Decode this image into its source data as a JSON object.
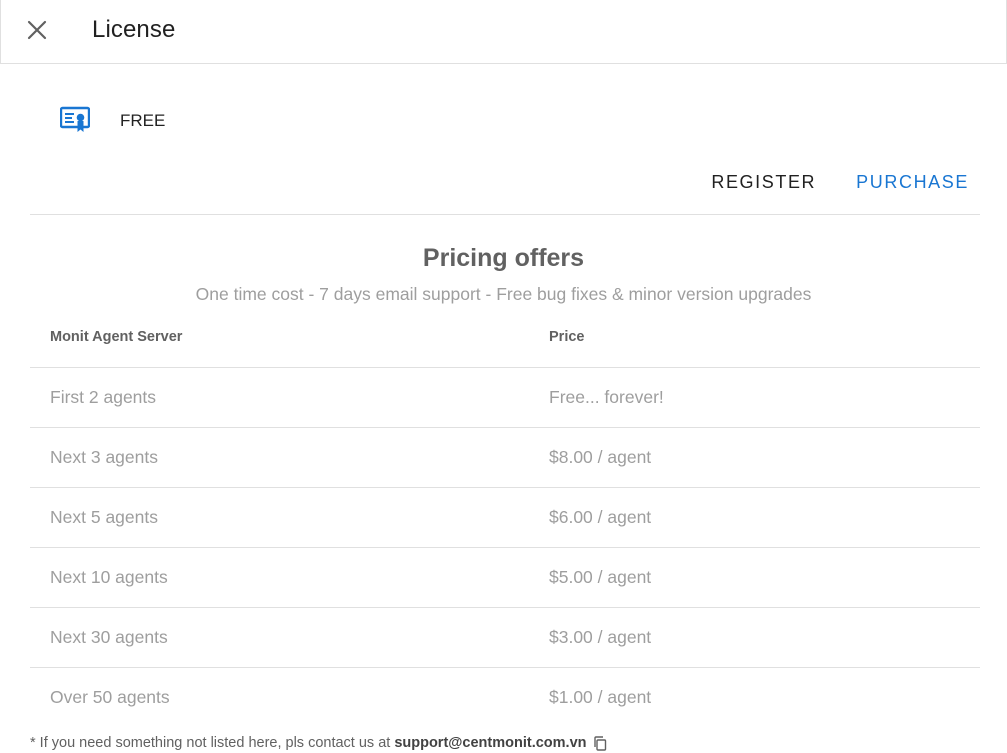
{
  "toolbar": {
    "title": "License",
    "close_icon": "close-icon"
  },
  "license": {
    "icon": "certificate-icon",
    "icon_color": "#1976d2",
    "status": "FREE"
  },
  "actions": {
    "register_label": "REGISTER",
    "purchase_label": "PURCHASE",
    "accent_color": "#1976d2"
  },
  "pricing": {
    "title": "Pricing offers",
    "subtitle": "One time cost - 7 days email support - Free bug fixes & minor version upgrades",
    "headers": [
      "Monit Agent Server",
      "Price"
    ],
    "rows": [
      {
        "tier": "First 2 agents",
        "price": "Free... forever!"
      },
      {
        "tier": "Next 3 agents",
        "price": "$8.00 / agent"
      },
      {
        "tier": "Next 5 agents",
        "price": "$6.00 / agent"
      },
      {
        "tier": "Next 10 agents",
        "price": "$5.00 / agent"
      },
      {
        "tier": "Next 30 agents",
        "price": "$3.00 / agent"
      },
      {
        "tier": "Over 50 agents",
        "price": "$1.00 / agent"
      }
    ]
  },
  "footer": {
    "note": "* If you need something not listed here, pls contact us at",
    "email": "support@centmonit.com.vn",
    "copy_icon": "copy-icon"
  }
}
